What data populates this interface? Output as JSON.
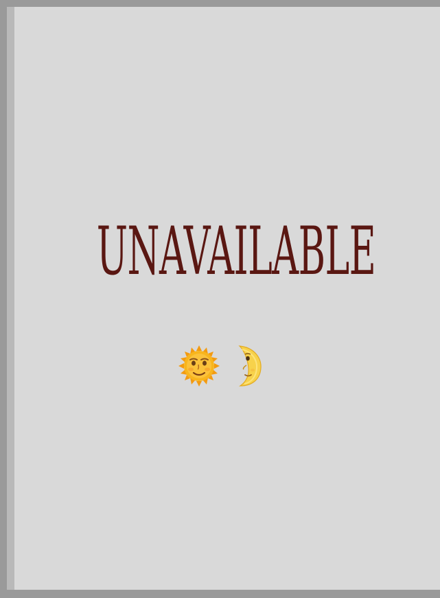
{
  "message": {
    "headline": "UNAVAILABLE"
  },
  "icons": [
    {
      "name": "sun-with-face-icon",
      "glyph": "🌞",
      "color": "#f6b11a"
    },
    {
      "name": "last-quarter-moon-with-face-icon",
      "glyph": "🌜",
      "color": "#f7d64a"
    }
  ],
  "colors": {
    "frame": "#9a9a9a",
    "panel": "#d9d9d9",
    "left_strip": "#b9b9b9",
    "headline": "#5a1712"
  }
}
